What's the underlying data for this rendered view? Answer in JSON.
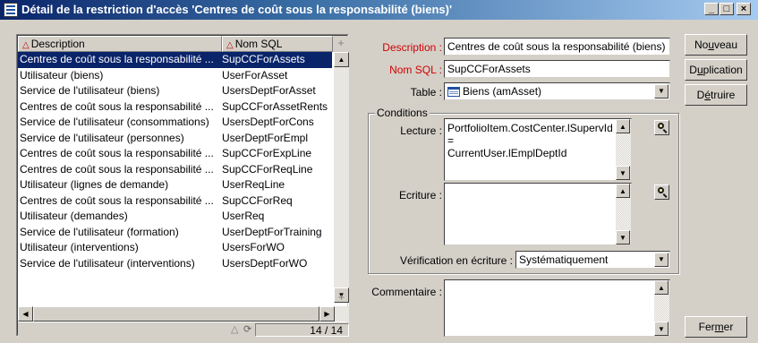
{
  "window": {
    "title": "Détail de la restriction d'accès 'Centres de coût sous la responsabilité (biens)'",
    "minimize": "_",
    "maximize": "□",
    "close": "×"
  },
  "list": {
    "columns": [
      "Description",
      "Nom SQL"
    ],
    "sort_icon": "sort-triangle-icon",
    "rows": [
      {
        "description": "Centres de coût sous la responsabilité ...",
        "sql": "SupCCForAssets"
      },
      {
        "description": "Utilisateur (biens)",
        "sql": "UserForAsset"
      },
      {
        "description": "Service de l'utilisateur (biens)",
        "sql": "UsersDeptForAsset"
      },
      {
        "description": "Centres de coût sous la responsabilité ...",
        "sql": "SupCCForAssetRents"
      },
      {
        "description": "Service de l'utilisateur (consommations)",
        "sql": "UsersDeptForCons"
      },
      {
        "description": "Service de l'utilisateur (personnes)",
        "sql": "UserDeptForEmpl"
      },
      {
        "description": "Centres de coût sous la responsabilité ...",
        "sql": "SupCCForExpLine"
      },
      {
        "description": "Centres de coût sous la responsabilité ...",
        "sql": "SupCCForReqLine"
      },
      {
        "description": "Utilisateur (lignes de demande)",
        "sql": "UserReqLine"
      },
      {
        "description": "Centres de coût sous la responsabilité ...",
        "sql": "SupCCForReq"
      },
      {
        "description": "Utilisateur (demandes)",
        "sql": "UserReq"
      },
      {
        "description": "Service de l'utilisateur (formation)",
        "sql": "UserDeptForTraining"
      },
      {
        "description": "Utilisateur (interventions)",
        "sql": "UsersForWO"
      },
      {
        "description": "Service de l'utilisateur (interventions)",
        "sql": "UsersDeptForWO"
      }
    ],
    "selected_index": 0,
    "counter": "14 / 14"
  },
  "form": {
    "description_label": "Description :",
    "description_value": "Centres de coût sous la responsabilité (biens)",
    "sqlname_label": "Nom SQL :",
    "sqlname_value": "SupCCForAssets",
    "table_label": "Table :",
    "table_value": "Biens (amAsset)",
    "conditions_title": "Conditions",
    "read_label": "Lecture :",
    "read_value_line1": "PortfolioItem.CostCenter.lSupervId =",
    "read_value_line2": "CurrentUser.lEmplDeptId",
    "write_label": "Ecriture :",
    "write_value": "",
    "check_label": "Vérification en écriture :",
    "check_value": "Systématiquement",
    "comment_label": "Commentaire :",
    "comment_value": ""
  },
  "buttons": {
    "new": {
      "pre": "No",
      "accel": "u",
      "post": "veau"
    },
    "duplicate": {
      "pre": "D",
      "accel": "u",
      "post": "plication"
    },
    "destroy": {
      "pre": "D",
      "accel": "é",
      "post": "truire"
    },
    "close": {
      "pre": "Fer",
      "accel": "m",
      "post": "er"
    }
  },
  "colors": {
    "selection": "#0a246a",
    "required_label": "#d00000",
    "face": "#d4d0c8"
  }
}
